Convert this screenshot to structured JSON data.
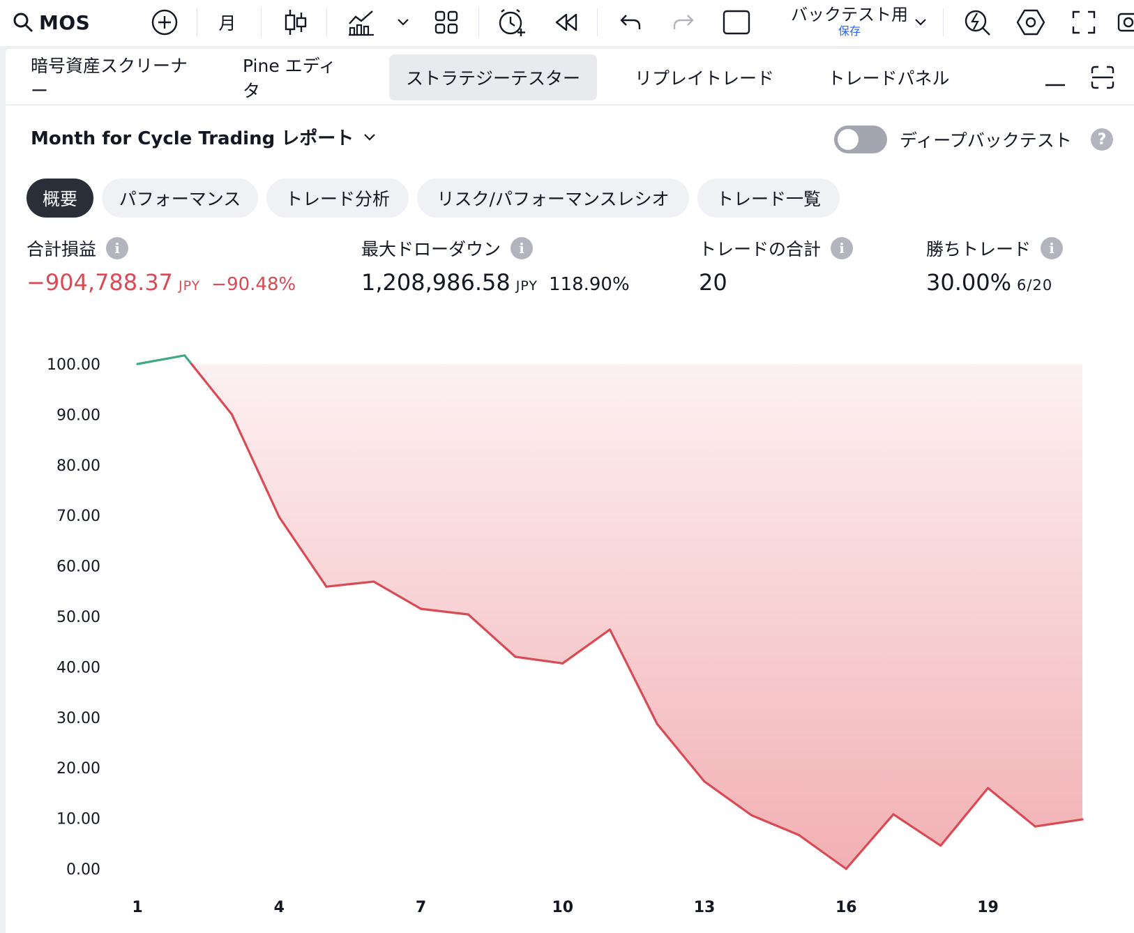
{
  "toolbar": {
    "symbol": "MOS",
    "interval": "月",
    "layout_name": "バックテスト用",
    "layout_status": "保存",
    "icons": [
      "search-icon",
      "add-symbol-icon",
      "candles-icon",
      "indicators-icon",
      "chevron-down-icon",
      "layouts-icon",
      "alert-icon",
      "replay-icon",
      "undo-icon",
      "redo-icon",
      "layout-square-icon",
      "chevron-down-icon",
      "quick-search-icon",
      "settings-icon",
      "fullscreen-icon",
      "camera-icon"
    ]
  },
  "tabs": [
    {
      "label": "暗号資産スクリーナー"
    },
    {
      "label": "Pine エディタ"
    },
    {
      "label": "ストラテジーテスター",
      "active": true
    },
    {
      "label": "リプレイトレード"
    },
    {
      "label": "トレードパネル"
    }
  ],
  "report": {
    "title": "Month for Cycle Trading レポート",
    "deep_backtest_label": "ディープバックテスト",
    "deep_backtest_enabled": false,
    "help": "?"
  },
  "pills": [
    {
      "label": "概要",
      "active": true
    },
    {
      "label": "パフォーマンス"
    },
    {
      "label": "トレード分析"
    },
    {
      "label": "リスク/パフォーマンスレシオ"
    },
    {
      "label": "トレード一覧"
    }
  ],
  "stats": {
    "net_profit": {
      "label": "合計損益",
      "value": "−904,788.37",
      "unit": "JPY",
      "percent": "−90.48%"
    },
    "max_drawdown": {
      "label": "最大ドローダウン",
      "value": "1,208,986.58",
      "unit": "JPY",
      "percent": "118.90%"
    },
    "total_trades": {
      "label": "トレードの合計",
      "value": "20"
    },
    "win_trades": {
      "label": "勝ちトレード",
      "value": "30.00%",
      "ratio": "6/20"
    }
  },
  "colors": {
    "loss": "#d84a54",
    "gain": "#3fa886",
    "fill_top": "#fdf1f2",
    "fill_bottom": "#f2b0b4",
    "active_pill": "#2a2e39"
  },
  "chart_data": {
    "type": "area",
    "x": [
      1,
      2,
      3,
      4,
      5,
      6,
      7,
      8,
      9,
      10,
      11,
      12,
      13,
      14,
      15,
      16,
      17,
      18,
      19,
      20,
      21
    ],
    "values": [
      100,
      101.7,
      90,
      69.7,
      55.9,
      56.9,
      51.5,
      50.4,
      42,
      40.7,
      47.4,
      28.7,
      17.3,
      10.6,
      6.7,
      0,
      10.8,
      4.6,
      16,
      8.4,
      9.8
    ],
    "ylim": [
      0,
      100
    ],
    "y_ticks": [
      "100.00",
      "90.00",
      "80.00",
      "70.00",
      "60.00",
      "50.00",
      "40.00",
      "30.00",
      "20.00",
      "10.00",
      "0.00"
    ],
    "x_ticks": [
      "1",
      "4",
      "7",
      "10",
      "13",
      "16",
      "19"
    ],
    "baseline": 100,
    "grid": false
  }
}
